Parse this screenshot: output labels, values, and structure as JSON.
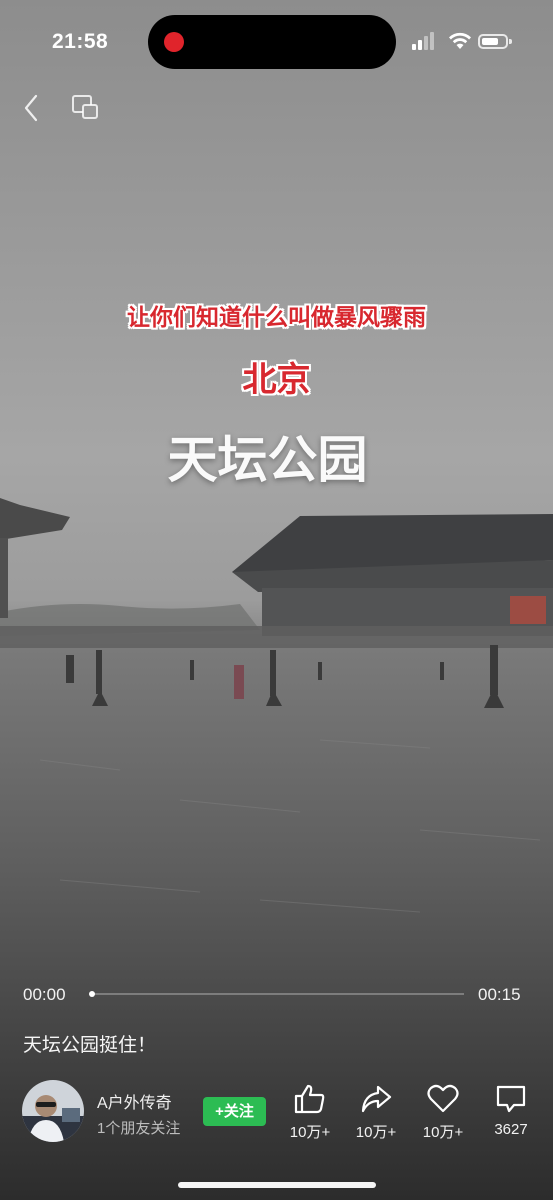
{
  "status_bar": {
    "time": "21:58"
  },
  "video": {
    "caption_line1": "让你们知道什么叫做暴风骤雨",
    "caption_line2": "北京",
    "caption_line3": "天坛公园",
    "current_time": "00:00",
    "duration": "00:15",
    "progress_fraction": 0.0
  },
  "post": {
    "description": "天坛公园挺住！"
  },
  "author": {
    "name": "A户外传奇",
    "subtitle": "1个朋友关注",
    "follow_label": "+关注"
  },
  "actions": [
    {
      "name": "like",
      "icon": "thumbs-up-icon",
      "count": "10万+"
    },
    {
      "name": "share",
      "icon": "share-icon",
      "count": "10万+"
    },
    {
      "name": "favorite",
      "icon": "heart-icon",
      "count": "10万+"
    },
    {
      "name": "comment",
      "icon": "comment-icon",
      "count": "3627"
    }
  ],
  "colors": {
    "accent_green": "#2cbc53",
    "caption_red": "#d8282f",
    "record_red": "#e0242b"
  }
}
